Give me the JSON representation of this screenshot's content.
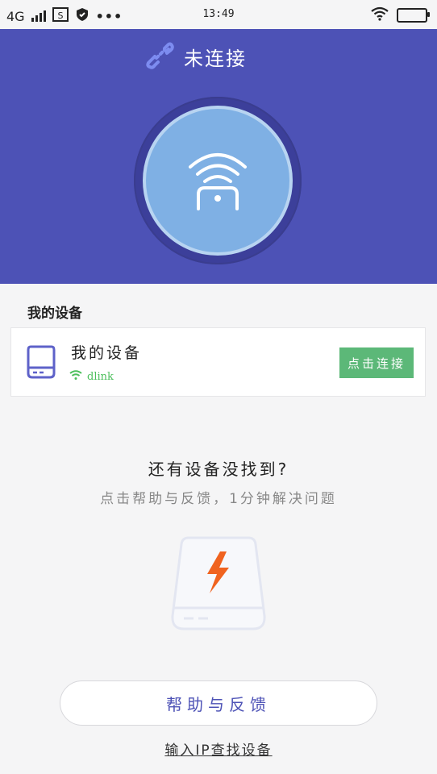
{
  "status_bar": {
    "network": "4G",
    "time": "13:49"
  },
  "header": {
    "connection_status": "未连接"
  },
  "my_devices": {
    "section_title": "我的设备",
    "device": {
      "name": "我的设备",
      "wifi_name": "dlink",
      "connect_label": "点击连接"
    }
  },
  "not_found": {
    "title": "还有设备没找到?",
    "subtitle": "点击帮助与反馈，1分钟解决问题"
  },
  "help_button": "帮助与反馈",
  "ip_link": "输入IP查找设备",
  "colors": {
    "header_bg": "#4d52b6",
    "connect_btn": "#5cb878",
    "wifi_green": "#4cbf5c",
    "orb": "#7fb0e4",
    "bolt": "#f0631f"
  }
}
